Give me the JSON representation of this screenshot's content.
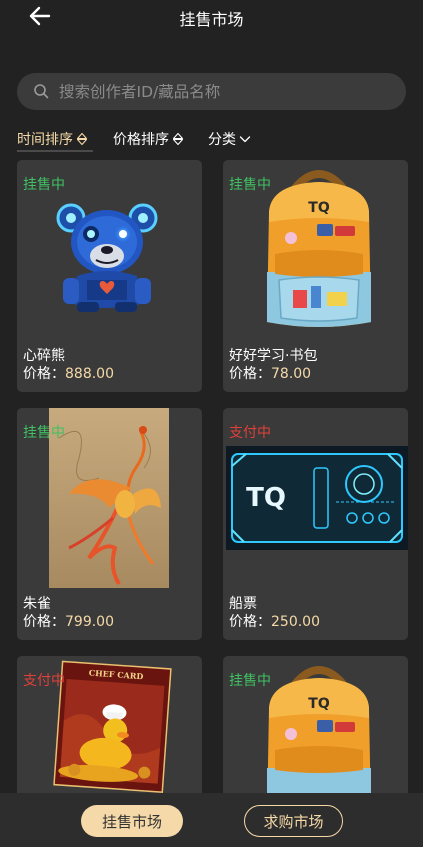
{
  "header": {
    "title": "挂售市场",
    "back_icon": "arrow-left-icon"
  },
  "search": {
    "placeholder": "搜索创作者ID/藏品名称",
    "value": ""
  },
  "sort": {
    "time_label": "时间排序",
    "price_label": "价格排序",
    "filter_label": "分类",
    "active": "time"
  },
  "price_prefix": "价格：",
  "items": [
    {
      "status": "挂售中",
      "name": "心碎熊",
      "price": "888.00",
      "art": "robot-bear"
    },
    {
      "status": "挂售中",
      "name": "好好学习·书包",
      "price": "78.00",
      "art": "orange-backpack"
    },
    {
      "status": "挂售中",
      "name": "朱雀",
      "price": "799.00",
      "art": "phoenix-painting"
    },
    {
      "status": "支付中",
      "name": "船票",
      "price": "250.00",
      "art": "tech-ticket"
    },
    {
      "status": "支付中",
      "name": "",
      "price": "",
      "art": "chef-card"
    },
    {
      "status": "挂售中",
      "name": "",
      "price": "",
      "art": "orange-backpack"
    }
  ],
  "tech_ticket_brand": "TQ",
  "chef_card_text": "CHEF CARD",
  "tabs": {
    "sale_label": "挂售市场",
    "buy_label": "求购市场",
    "active": "sale"
  },
  "colors": {
    "background": "#222222",
    "card": "#3a3a3a",
    "accent": "#f5d9a8",
    "on_sale": "#3fc063",
    "paying": "#e0403a"
  }
}
